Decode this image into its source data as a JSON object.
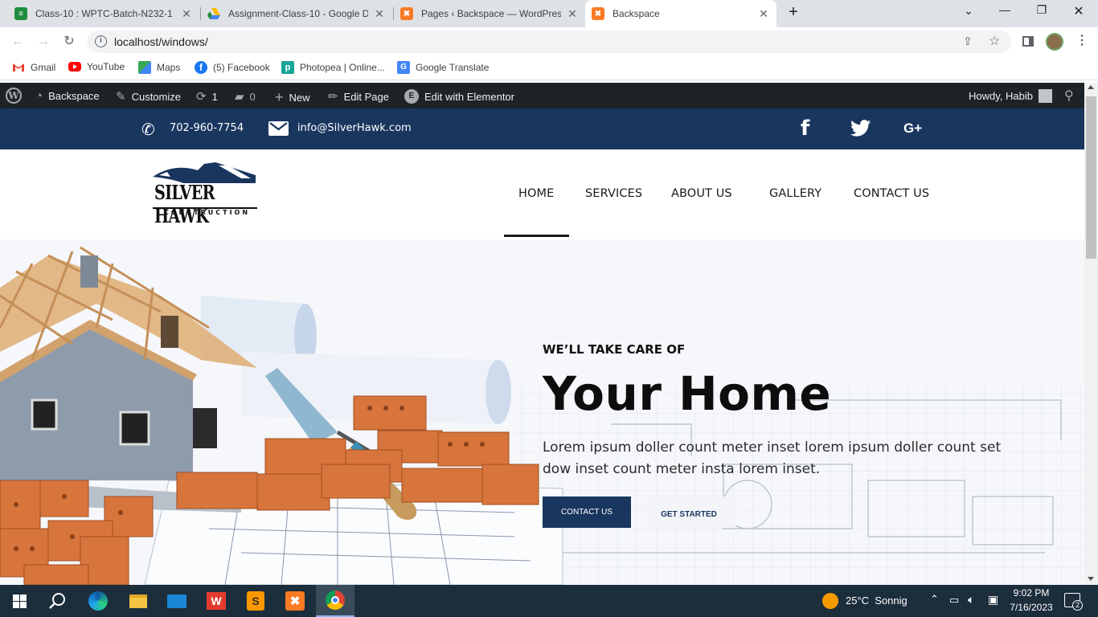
{
  "browser": {
    "tabs": [
      {
        "title": "Class-10 : WPTC-Batch-N232-1 -",
        "favicon": "classroom-icon",
        "color": "#1e8e3e"
      },
      {
        "title": "Assignment-Class-10 - Google D",
        "favicon": "google-drive-icon",
        "color": "#fbbc04"
      },
      {
        "title": "Pages ‹ Backspace — WordPress",
        "favicon": "xampp-icon",
        "color": "#fb7a24"
      },
      {
        "title": "Backspace",
        "favicon": "xampp-icon",
        "color": "#fb7a24"
      }
    ],
    "url": "localhost/windows/",
    "bookmarks": [
      {
        "label": "Gmail",
        "icon": "gmail-icon"
      },
      {
        "label": "YouTube",
        "icon": "youtube-icon"
      },
      {
        "label": "Maps",
        "icon": "maps-icon"
      },
      {
        "label": "(5) Facebook",
        "icon": "facebook-icon"
      },
      {
        "label": "Photopea | Online...",
        "icon": "photopea-icon"
      },
      {
        "label": "Google Translate",
        "icon": "translate-icon"
      }
    ]
  },
  "adminbar": {
    "site": "Backspace",
    "customize": "Customize",
    "updates": "1",
    "comments": "0",
    "new": "New",
    "edit_page": "Edit Page",
    "elementor": "Edit with Elementor",
    "howdy": "Howdy, Habib"
  },
  "site": {
    "phone": "702-960-7754",
    "email": "info@SilverHawk.com",
    "social": [
      "facebook-icon",
      "twitter-icon",
      "google-plus-icon"
    ],
    "social_gplus_label": "G+",
    "logo_main": "SILVER HAWK",
    "logo_sub": "CONSTRUCTION",
    "nav": [
      "HOME",
      "SERVICES",
      "ABOUT US",
      "GALLERY",
      "CONTACT US"
    ],
    "active_nav": "HOME",
    "hero": {
      "kicker": "WE’LL TAKE CARE OF",
      "title": "Your Home",
      "text": "Lorem ipsum doller count meter inset lorem ipsum doller count set dow inset count meter insta lorem inset.",
      "btn_contact": "CONTACT US",
      "btn_start": "GET STARTED"
    },
    "colors": {
      "navy": "#19365f",
      "accent": "#1b3a64"
    }
  },
  "taskbar": {
    "weather": "25°C  Sonnig",
    "time": "9:02 PM",
    "date": "7/16/2023",
    "notifications": "2"
  }
}
